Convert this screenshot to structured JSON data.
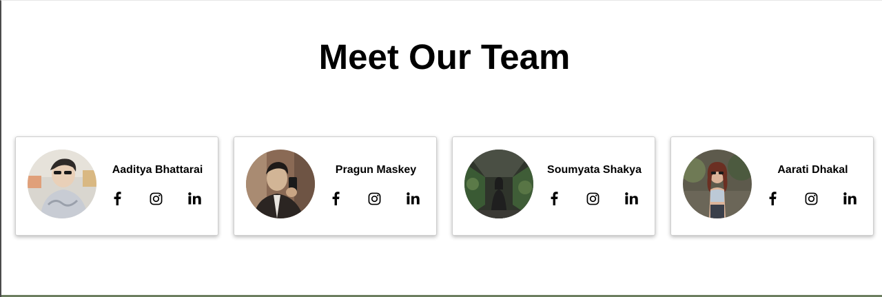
{
  "page": {
    "title": "Meet Our Team"
  },
  "team": [
    {
      "name": "Aaditya Bhattarai",
      "avatar_colors": [
        "#d9d6cf",
        "#3a3432",
        "#e9d0b8",
        "#c8ccd4"
      ]
    },
    {
      "name": "Pragun Maskey",
      "avatar_colors": [
        "#8a6a55",
        "#2b2522",
        "#d2b596",
        "#3d3d44"
      ]
    },
    {
      "name": "Soumyata Shakya",
      "avatar_colors": [
        "#3e4438",
        "#1c1c1c",
        "#c4a58c",
        "#2a2a2a"
      ]
    },
    {
      "name": "Aarati Dhakal",
      "avatar_colors": [
        "#5d5a4c",
        "#6b2f22",
        "#dcb49a",
        "#bcc9d6"
      ]
    }
  ],
  "socials": [
    {
      "label": "facebook-icon"
    },
    {
      "label": "instagram-icon"
    },
    {
      "label": "linkedin-icon"
    }
  ]
}
